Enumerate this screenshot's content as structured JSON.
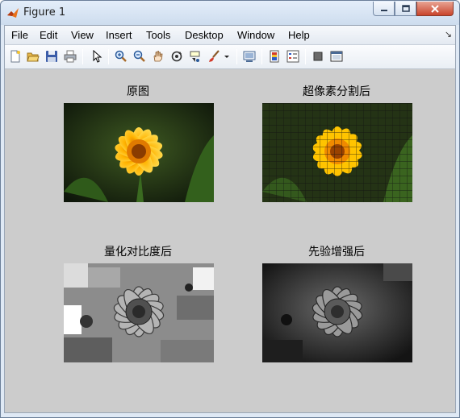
{
  "window": {
    "title": "Figure 1",
    "controls": [
      "minimize",
      "maximize",
      "close"
    ]
  },
  "menubar": {
    "items": [
      "File",
      "Edit",
      "View",
      "Insert",
      "Tools",
      "Desktop",
      "Window",
      "Help"
    ],
    "pin_glyph": "↘"
  },
  "toolbar": {
    "buttons": [
      "new-figure-icon",
      "open-file-icon",
      "save-icon",
      "print-icon",
      "edit-plot-arrow-icon",
      "zoom-in-icon",
      "zoom-out-icon",
      "pan-hand-icon",
      "rotate-3d-icon",
      "data-cursor-icon",
      "brush-icon",
      "brush-dropdown-icon",
      "link-plot-icon",
      "colorbar-icon",
      "legend-icon",
      "hide-plot-tools-icon",
      "show-plot-tools-icon"
    ]
  },
  "figure": {
    "background": "#cccccc",
    "axes": [
      {
        "title": "原图",
        "kind": "original-color"
      },
      {
        "title": "超像素分割后",
        "kind": "superpixel-color"
      },
      {
        "title": "量化对比度后",
        "kind": "quantized-gray"
      },
      {
        "title": "先验增强后",
        "kind": "prior-enhanced-gray"
      }
    ]
  },
  "colors": {
    "petal_yellow": "#ffc400",
    "petal_orange": "#f08a00",
    "center_brown": "#8a3c00",
    "leaf_green": "#2f5a1a",
    "background_dark": "#1a2410"
  }
}
